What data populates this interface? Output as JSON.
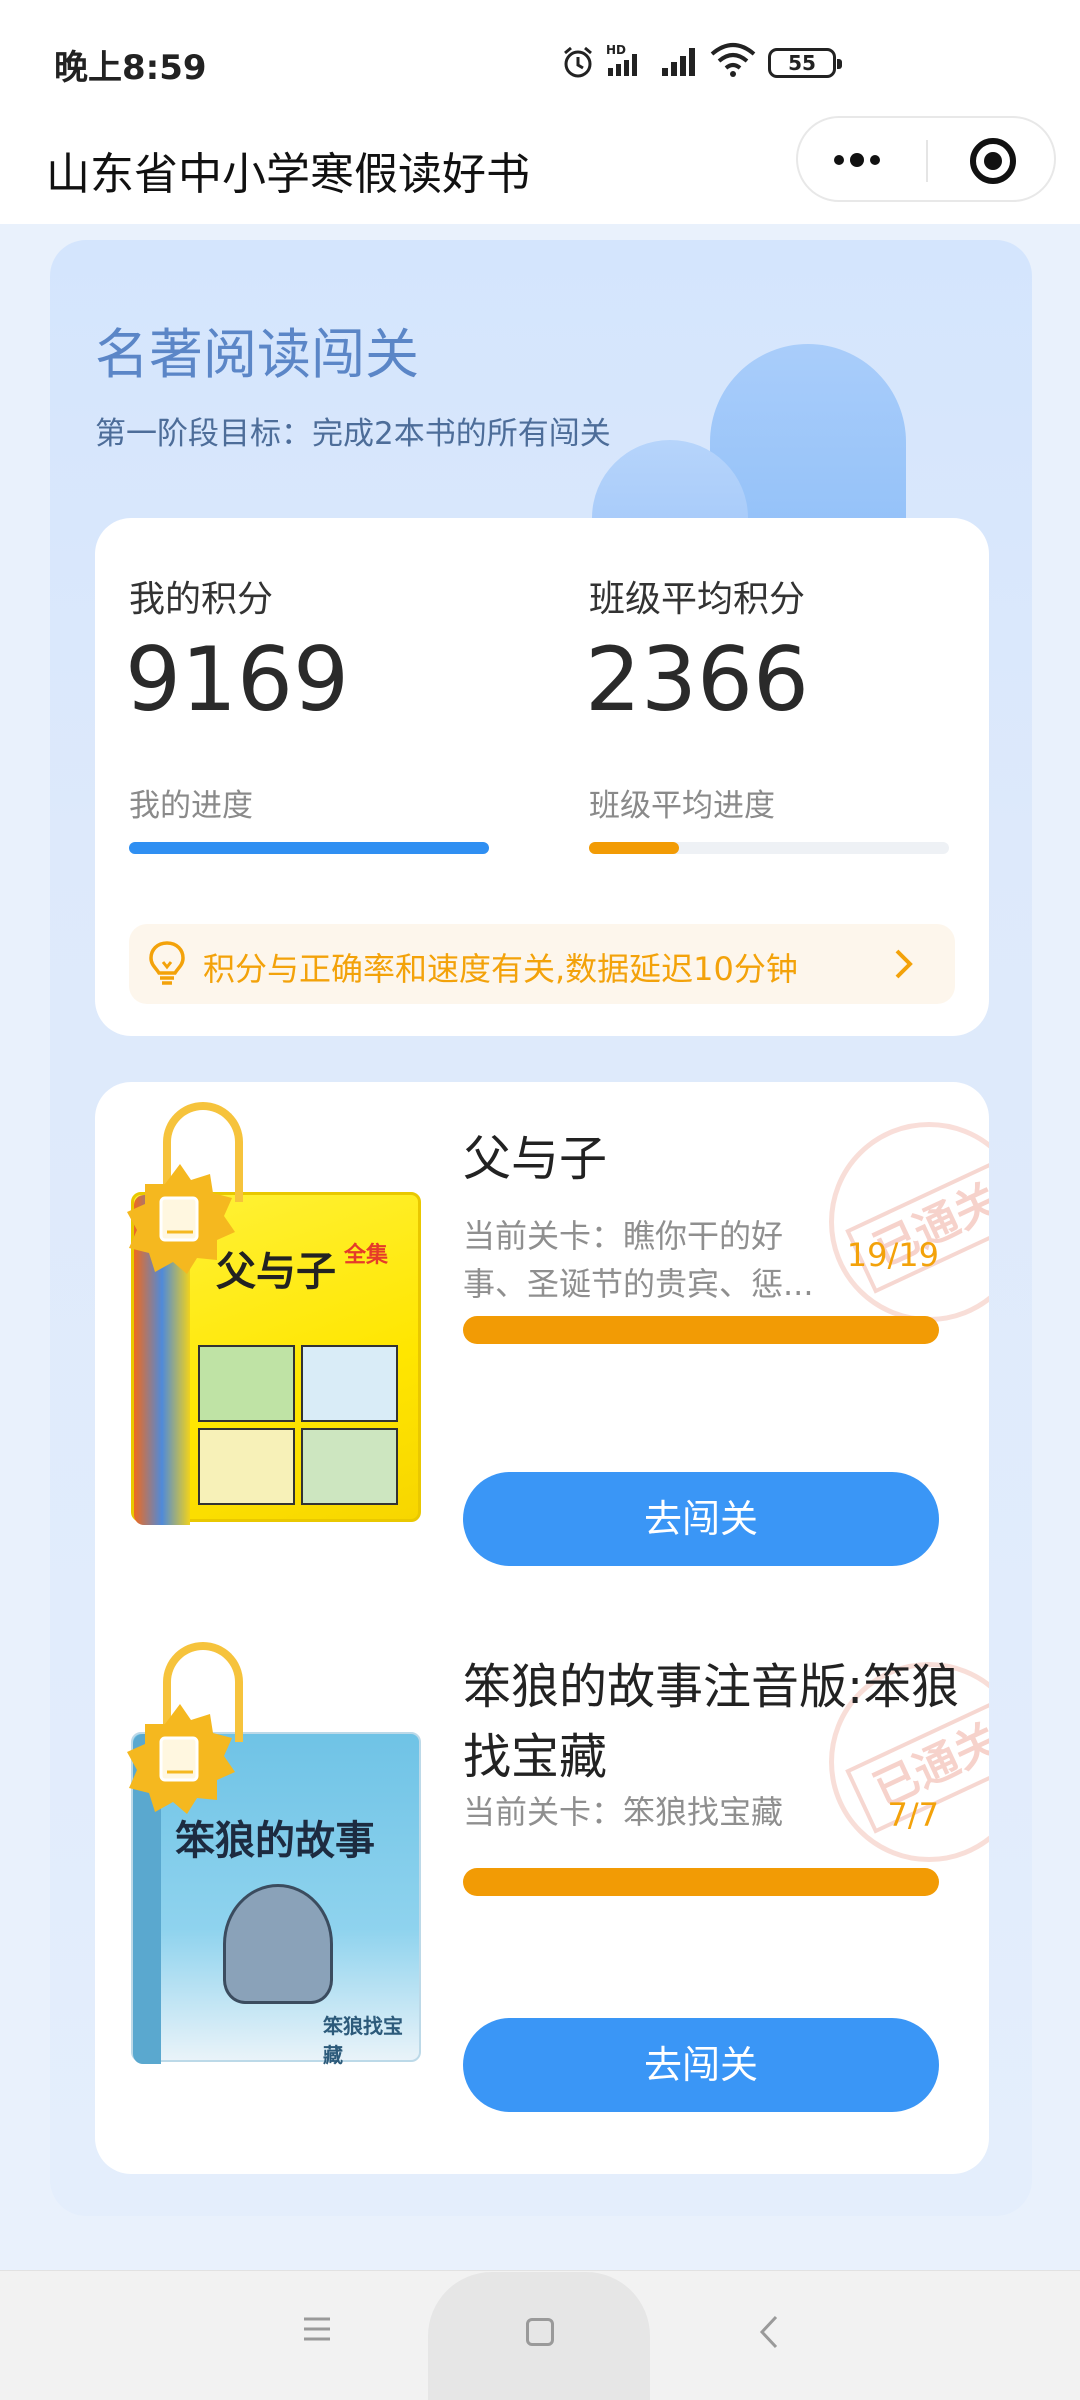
{
  "status_bar": {
    "time": "晚上8:59",
    "battery": "55",
    "network_label": "HD"
  },
  "title_bar": {
    "title": "山东省中小学寒假读好书"
  },
  "section": {
    "title": "名著阅读闯关",
    "subtitle": "第一阶段目标：完成2本书的所有闯关"
  },
  "scores": {
    "my_score_label": "我的积分",
    "my_score": "9169",
    "class_avg_label": "班级平均积分",
    "class_avg": "2366",
    "my_progress_label": "我的进度",
    "my_progress": 1.0,
    "class_progress_label": "班级平均进度",
    "class_progress": 0.25,
    "tip": "积分与正确率和速度有关,数据延迟10分钟"
  },
  "books": [
    {
      "title": "父与子",
      "level": "当前关卡：瞧你干的好事、圣诞节的贵宾、惩...",
      "count": "19/19",
      "progress": 1.0,
      "button": "去闯关",
      "stamp": "已通关",
      "cover_title": "父与子",
      "cover_subtitle": "全集"
    },
    {
      "title": "笨狼的故事注音版:笨狼找宝藏",
      "level": "当前关卡：笨狼找宝藏",
      "count": "7/7",
      "progress": 1.0,
      "button": "去闯关",
      "stamp": "已通关",
      "cover_title": "笨狼的故事",
      "cover_subtitle": "笨狼找宝藏"
    }
  ],
  "colors": {
    "accent_blue": "#3a96f6",
    "accent_orange": "#f29b05",
    "tip_orange": "#f3a20a"
  }
}
